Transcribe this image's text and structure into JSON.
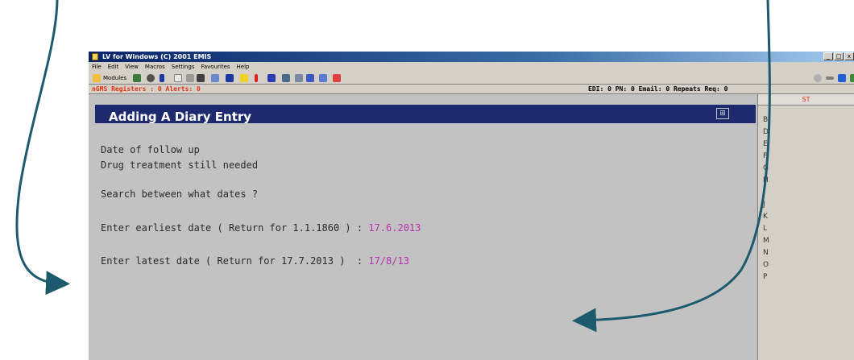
{
  "window": {
    "title": "LV for Windows (C) 2001 EMIS",
    "buttons": [
      "_",
      "□",
      "x"
    ]
  },
  "menu": [
    "File",
    "Edit",
    "View",
    "Macros",
    "Settings",
    "Favourites",
    "Help"
  ],
  "toolbar": {
    "modules_label": "Modules",
    "icons": [
      "modules-icon",
      "people-icon",
      "clock-icon",
      "book-icon",
      "copy-icon",
      "print-icon",
      "camera-icon",
      "syringe-icon",
      "flask-icon",
      "star-icon",
      "alert-icon",
      "card-icon",
      "mail-icon",
      "screen-icon",
      "chart-icon",
      "report-icon",
      "cancel-icon"
    ],
    "right_icons": [
      "circle-icon",
      "back-arrow-icon",
      "save-icon",
      "tree-icon"
    ]
  },
  "status": {
    "left": "nGMS Registers : 0  Alerts: 0",
    "right": "EDI: 0  PN: 0  Email: 0  Repeats Req: 0"
  },
  "panel": {
    "title": "Adding A Diary Entry",
    "lines": [
      {
        "text": "Date of follow up"
      },
      {
        "text": "Drug treatment still needed"
      },
      {
        "text": "Search between what dates ?"
      },
      {
        "prompt": "Enter earliest date ( Return for 1.1.1860 ) : ",
        "value": "17.6.2013"
      },
      {
        "prompt": "Enter latest date ( Return for 17.7.2013 )  : ",
        "value": "17/8/13"
      }
    ]
  },
  "sidebar": {
    "header": "ST",
    "letters": [
      "B",
      "D",
      "E",
      "F",
      "G",
      "H",
      "I",
      "J",
      "K",
      "L",
      "M",
      "N",
      "O",
      "P"
    ]
  },
  "colors": {
    "arrow": "#1d5a6e",
    "entered_value": "#b82fb2",
    "header_bg": "#1e2a6e",
    "status_alert": "#e8320c"
  }
}
